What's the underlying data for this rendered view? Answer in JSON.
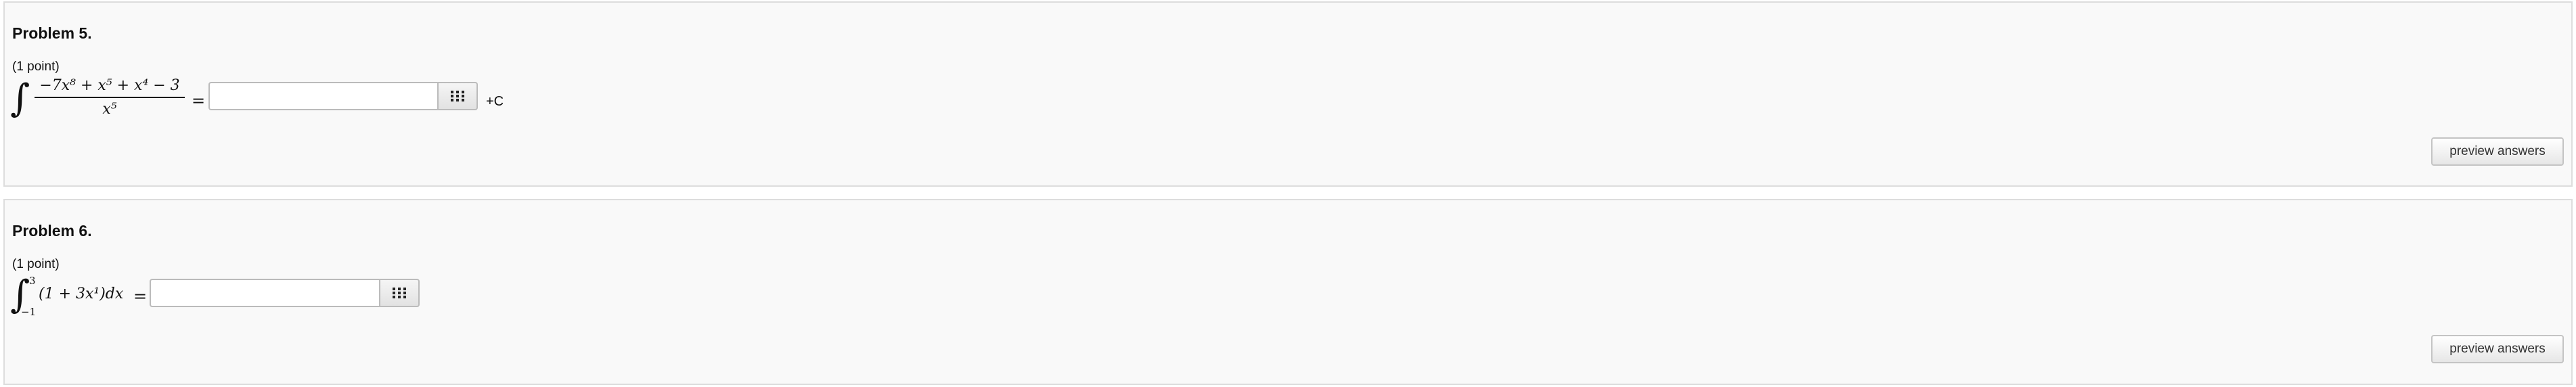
{
  "problems": [
    {
      "title": "Problem 5.",
      "points": "(1 point)",
      "integral_sign": "∫",
      "numerator": "−7x⁸ + x⁵ + x⁴ − 3",
      "denominator": "x⁵",
      "equals": "=",
      "answer_value": "",
      "suffix": "+C",
      "preview_label": "preview answers"
    },
    {
      "title": "Problem 6.",
      "points": "(1 point)",
      "integral_sign": "∫",
      "upper_limit": "3",
      "lower_limit": "−1",
      "integrand": "(1 + 3x¹)dx",
      "equals": "=",
      "answer_value": "",
      "preview_label": "preview answers"
    }
  ],
  "icons": {
    "equation_editor": "keypad-grid-icon"
  }
}
